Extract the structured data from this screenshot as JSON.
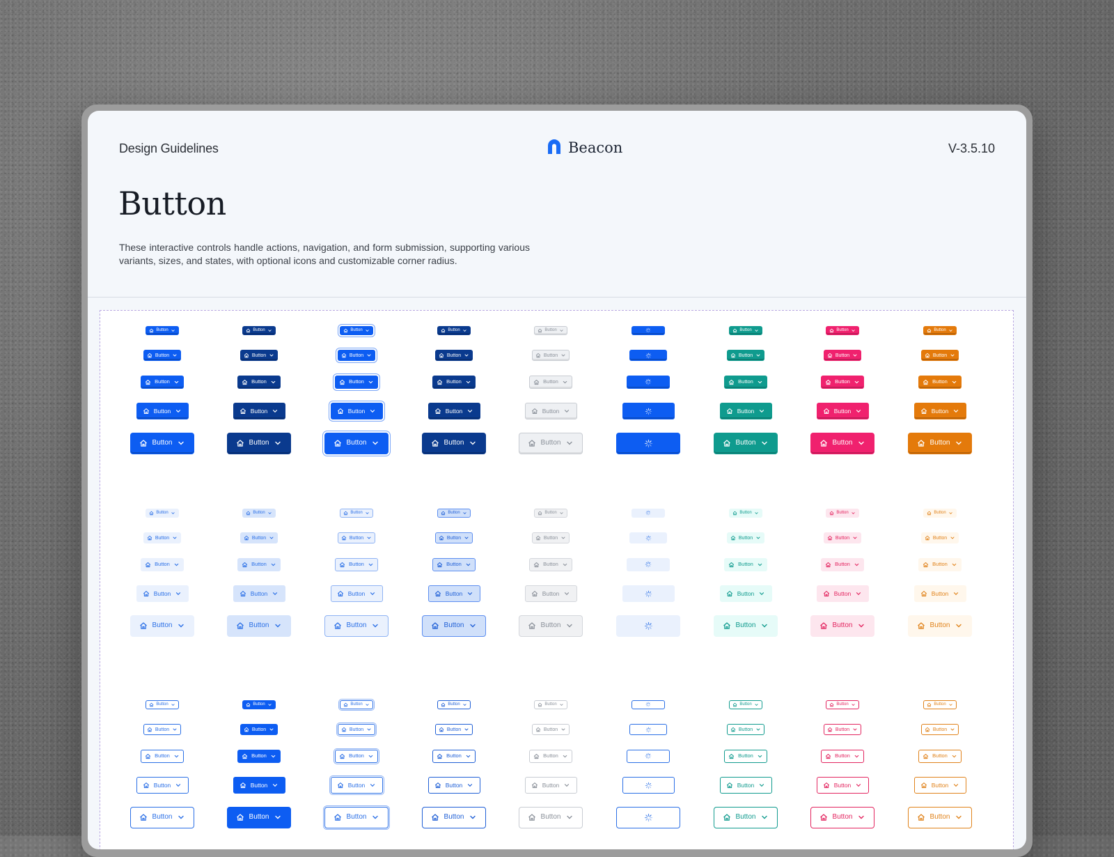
{
  "header": {
    "left": "Design Guidelines",
    "brand": "Beacon",
    "version": "V-3.5.10"
  },
  "page": {
    "title": "Button",
    "description": "These interactive controls handle actions, navigation, and form submission, supporting various variants, sizes, and states, with optional icons and customizable corner radius."
  },
  "button_label": "Button",
  "colors": {
    "primary": "#0d5df2",
    "primary_dark": "#0a3a8e",
    "teal": "#0f9b8e",
    "pink": "#f0216e",
    "orange": "#e47a0b",
    "gray_text": "#6b7280"
  },
  "icons": {
    "leading": "home-icon",
    "trailing": "chevron-down-icon",
    "loading": "spinner-icon",
    "brand": "beacon-logo-icon"
  },
  "groups": [
    {
      "name": "solid",
      "variants": [
        "primary",
        "pressed",
        "focused",
        "active",
        "disabled",
        "loading",
        "success",
        "danger",
        "warning"
      ]
    },
    {
      "name": "soft",
      "variants": [
        "primary",
        "pressed",
        "focused",
        "active",
        "disabled",
        "loading",
        "success",
        "danger",
        "warning"
      ]
    },
    {
      "name": "outline",
      "variants": [
        "primary",
        "pressed",
        "focused",
        "active",
        "disabled",
        "loading",
        "success",
        "danger",
        "warning"
      ]
    }
  ],
  "sizes": [
    "xs",
    "sm",
    "md",
    "lg",
    "xl"
  ]
}
